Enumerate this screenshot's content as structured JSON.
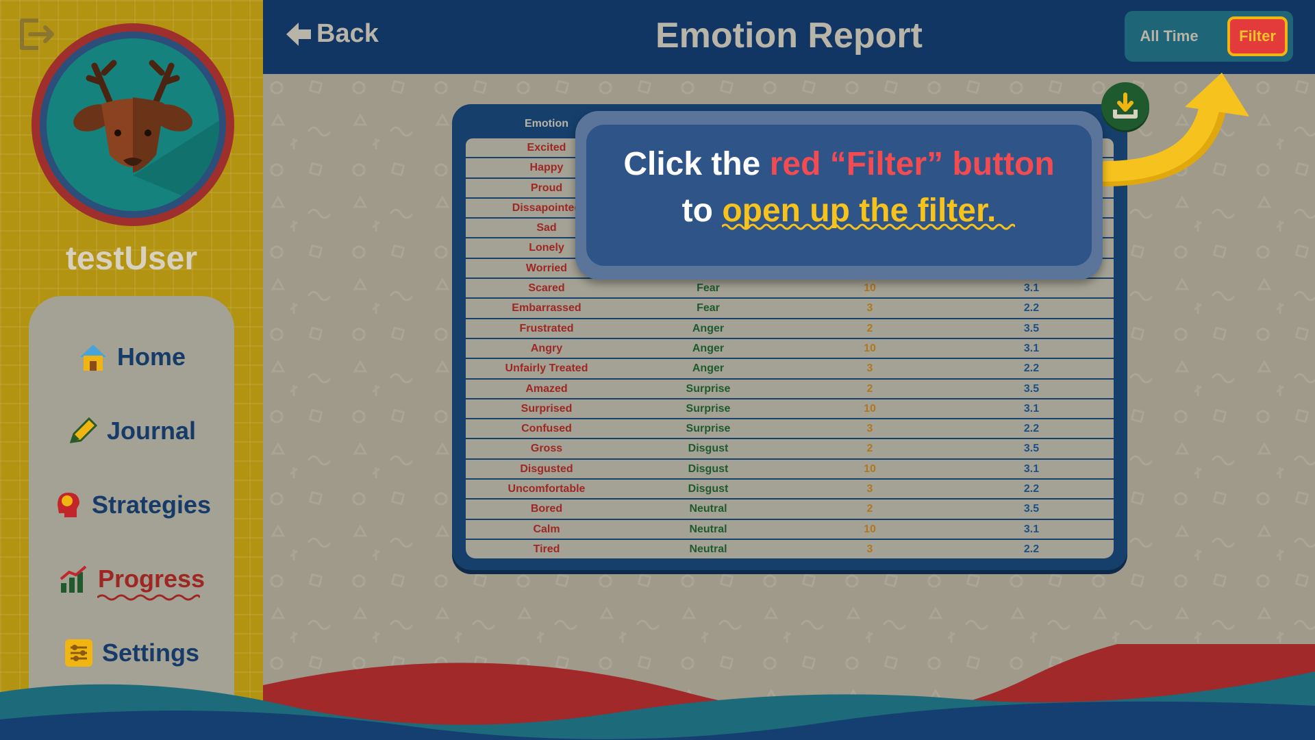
{
  "sidebar": {
    "username": "testUser",
    "nav": [
      {
        "label": "Home",
        "icon": "home-icon",
        "active": false
      },
      {
        "label": "Journal",
        "icon": "pencil-icon",
        "active": false
      },
      {
        "label": "Strategies",
        "icon": "brain-head-icon",
        "active": false
      },
      {
        "label": "Progress",
        "icon": "chart-icon",
        "active": true
      },
      {
        "label": "Settings",
        "icon": "sliders-icon",
        "active": false
      }
    ]
  },
  "header": {
    "back_label": "Back",
    "title": "Emotion Report",
    "all_time_label": "All Time",
    "filter_label": "Filter"
  },
  "table": {
    "header": {
      "emotion": "Emotion"
    },
    "rows": [
      {
        "emotion": "Excited",
        "category": "",
        "count": "",
        "avg": ""
      },
      {
        "emotion": "Happy",
        "category": "",
        "count": "",
        "avg": ""
      },
      {
        "emotion": "Proud",
        "category": "",
        "count": "",
        "avg": ""
      },
      {
        "emotion": "Dissapointed",
        "category": "",
        "count": "",
        "avg": ""
      },
      {
        "emotion": "Sad",
        "category": "",
        "count": "",
        "avg": ""
      },
      {
        "emotion": "Lonely",
        "category": "",
        "count": "",
        "avg": ""
      },
      {
        "emotion": "Worried",
        "category": "",
        "count": "",
        "avg": ""
      },
      {
        "emotion": "Scared",
        "category": "Fear",
        "count": "10",
        "avg": "3.1"
      },
      {
        "emotion": "Embarrassed",
        "category": "Fear",
        "count": "3",
        "avg": "2.2"
      },
      {
        "emotion": "Frustrated",
        "category": "Anger",
        "count": "2",
        "avg": "3.5"
      },
      {
        "emotion": "Angry",
        "category": "Anger",
        "count": "10",
        "avg": "3.1"
      },
      {
        "emotion": "Unfairly Treated",
        "category": "Anger",
        "count": "3",
        "avg": "2.2"
      },
      {
        "emotion": "Amazed",
        "category": "Surprise",
        "count": "2",
        "avg": "3.5"
      },
      {
        "emotion": "Surprised",
        "category": "Surprise",
        "count": "10",
        "avg": "3.1"
      },
      {
        "emotion": "Confused",
        "category": "Surprise",
        "count": "3",
        "avg": "2.2"
      },
      {
        "emotion": "Gross",
        "category": "Disgust",
        "count": "2",
        "avg": "3.5"
      },
      {
        "emotion": "Disgusted",
        "category": "Disgust",
        "count": "10",
        "avg": "3.1"
      },
      {
        "emotion": "Uncomfortable",
        "category": "Disgust",
        "count": "3",
        "avg": "2.2"
      },
      {
        "emotion": "Bored",
        "category": "Neutral",
        "count": "2",
        "avg": "3.5"
      },
      {
        "emotion": "Calm",
        "category": "Neutral",
        "count": "10",
        "avg": "3.1"
      },
      {
        "emotion": "Tired",
        "category": "Neutral",
        "count": "3",
        "avg": "2.2"
      }
    ]
  },
  "tooltip": {
    "line1_prefix": "Click the ",
    "line1_highlight": "red “Filter” button",
    "line2_prefix": "to ",
    "line2_highlight": "open up the filter."
  },
  "colors": {
    "header_bg": "#123663",
    "sidebar_bg": "#b29412",
    "filter_red": "#e33a3c",
    "highlight_yellow": "#f6c21e"
  }
}
